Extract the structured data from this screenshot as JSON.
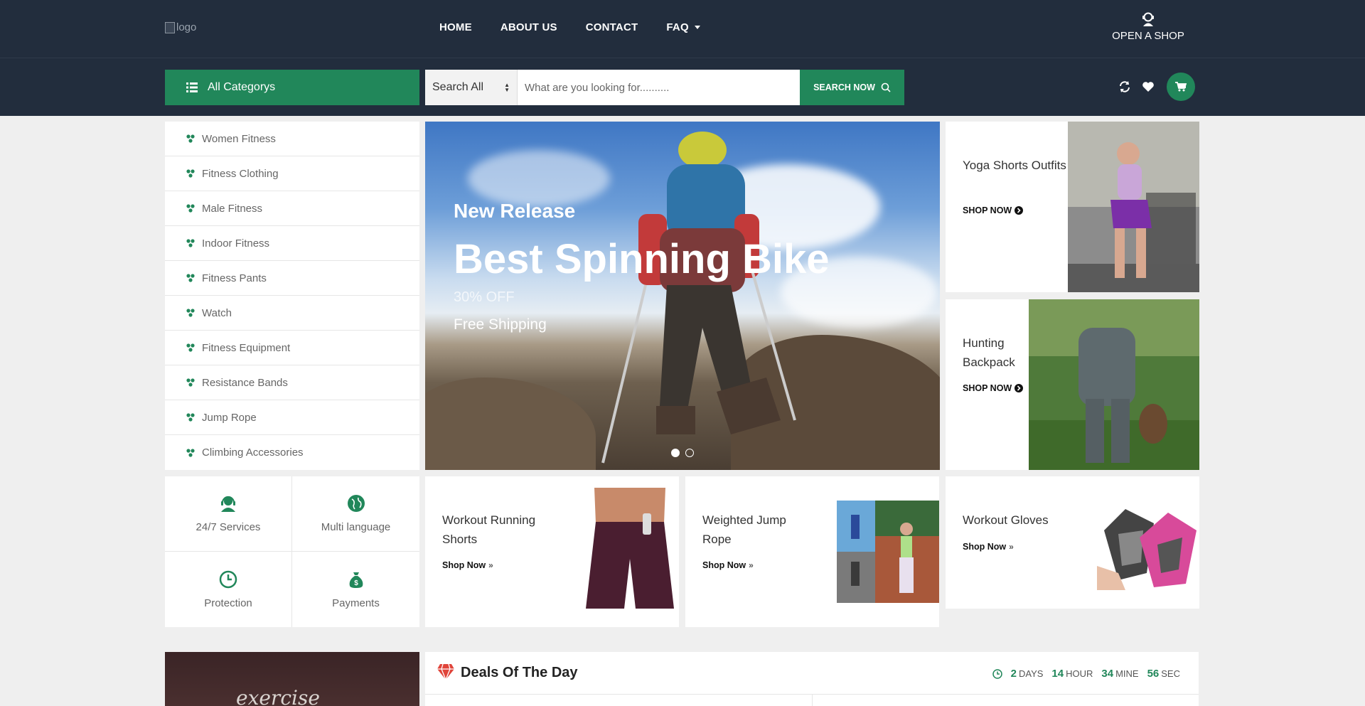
{
  "header": {
    "logo_alt": "logo",
    "nav": [
      {
        "label": "HOME"
      },
      {
        "label": "ABOUT US"
      },
      {
        "label": "CONTACT"
      },
      {
        "label": "FAQ"
      }
    ],
    "open_shop_label": "OPEN A SHOP"
  },
  "search": {
    "all_categories_label": "All Categorys",
    "select_value": "Search All",
    "placeholder": "What are you looking for..........",
    "button_label": "SEARCH NOW"
  },
  "categories": [
    {
      "label": "Women Fitness"
    },
    {
      "label": "Fitness Clothing"
    },
    {
      "label": "Male Fitness"
    },
    {
      "label": "Indoor Fitness"
    },
    {
      "label": "Fitness Pants"
    },
    {
      "label": "Watch"
    },
    {
      "label": "Fitness Equipment"
    },
    {
      "label": "Resistance Bands"
    },
    {
      "label": "Jump Rope"
    },
    {
      "label": "Climbing Accessories"
    }
  ],
  "hero": {
    "line1": "New Release",
    "line2": "Best Spinning Bike",
    "line3": "30% OFF",
    "line4": "Free Shipping"
  },
  "side_promos": [
    {
      "title": "Yoga Shorts Outfits",
      "cta": "SHOP NOW"
    },
    {
      "title": "Hunting Backpack",
      "cta": "SHOP NOW"
    }
  ],
  "features": [
    {
      "label": "24/7 Services",
      "icon": "support-agent-icon"
    },
    {
      "label": "Multi language",
      "icon": "globe-icon"
    },
    {
      "label": "Protection",
      "icon": "clock-icon"
    },
    {
      "label": "Payments",
      "icon": "money-bag-icon"
    }
  ],
  "product_promos": [
    {
      "title": "Workout Running Shorts",
      "cta": "Shop Now"
    },
    {
      "title": "Weighted Jump Rope",
      "cta": "Shop Now"
    },
    {
      "title": "Workout Gloves",
      "cta": "Shop Now"
    }
  ],
  "deals": {
    "title": "Deals Of The Day",
    "countdown": [
      {
        "value": "2",
        "unit": "DAYS"
      },
      {
        "value": "14",
        "unit": "HOUR"
      },
      {
        "value": "34",
        "unit": "MINE"
      },
      {
        "value": "56",
        "unit": "SEC"
      }
    ]
  },
  "bottom_banner": {
    "text": "exercise"
  },
  "colors": {
    "brand_green": "#21875a",
    "header_dark": "#222d3d",
    "page_bg": "#efefef"
  }
}
